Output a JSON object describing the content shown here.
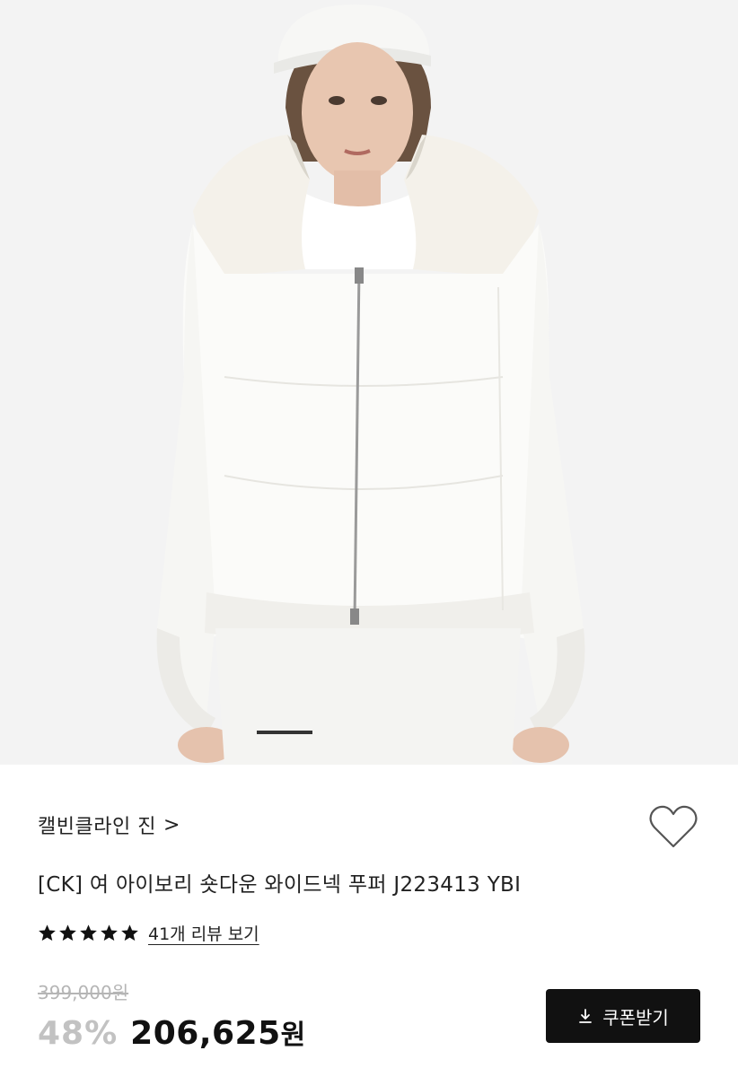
{
  "product": {
    "brand": "캘빈클라인 진",
    "brand_chevron": ">",
    "title": "[CK] 여 아이보리 숏다운 와이드넥 푸퍼 J223413 YBI",
    "rating": 5,
    "review_link": "41개 리뷰 보기",
    "original_price": "399,000원",
    "discount": "48%",
    "price_number": "206,625",
    "price_unit": "원",
    "coupon_button": "쿠폰받기",
    "icons": {
      "wishlist": "heart-outline-icon",
      "star": "star-filled-icon",
      "download": "download-icon"
    }
  },
  "gallery": {
    "slide_count": 6,
    "active_slide": 1
  },
  "colors": {
    "star": "#111111",
    "button_bg": "#111111",
    "discount": "#c2c2c2",
    "strikethrough": "#b5b5b5"
  }
}
